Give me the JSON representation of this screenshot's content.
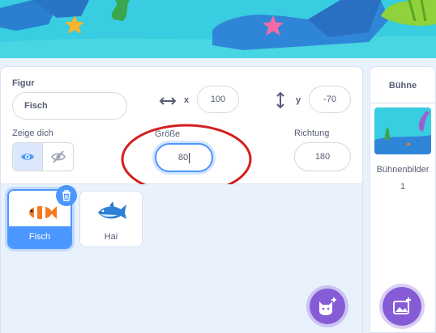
{
  "sprite_info": {
    "sprite_label": "Figur",
    "sprite_name": "Fisch",
    "x_label": "x",
    "x_value": "100",
    "y_label": "y",
    "y_value": "-70",
    "show_label": "Zeige dich",
    "size_label": "Größe",
    "size_value": "80",
    "direction_label": "Richtung",
    "direction_value": "180"
  },
  "sprites": [
    {
      "name": "Fisch",
      "selected": true
    },
    {
      "name": "Hai",
      "selected": false
    }
  ],
  "stage_panel": {
    "title": "Bühne",
    "backdrops_label": "Bühnenbilder",
    "backdrops_count": "1"
  },
  "colors": {
    "accent": "#4c97ff",
    "annotation": "#d41e1e",
    "stage_sea": "#2fc4d6"
  },
  "icons": [
    "eye-icon",
    "eye-off-icon",
    "horizontal-arrows-icon",
    "vertical-arrows-icon",
    "trash-icon",
    "choose-sprite-cat-icon",
    "choose-backdrop-icon",
    "starfish-icon"
  ]
}
